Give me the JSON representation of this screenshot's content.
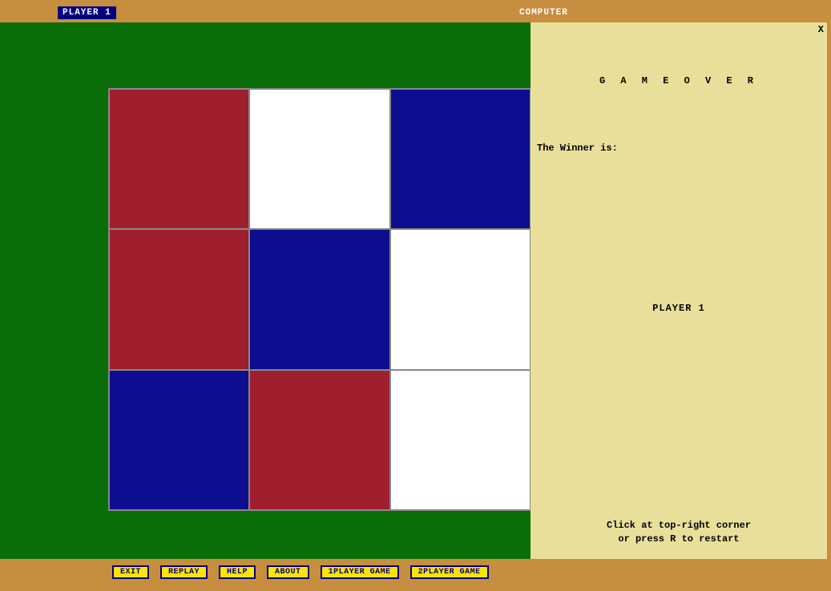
{
  "header": {
    "player1_label": "PLAYER 1",
    "computer_label": "COMPUTER"
  },
  "board": {
    "cells": [
      "red",
      "white",
      "blue",
      "red",
      "blue",
      "white",
      "blue",
      "red",
      "white"
    ]
  },
  "side_panel": {
    "close_symbol": "X",
    "game_over": "G A M E  O V E R",
    "winner_label": "The Winner is:",
    "winner_name": "PLAYER 1",
    "restart_line1": "Click at top-right corner",
    "restart_line2": "or press R to restart"
  },
  "buttons": {
    "exit": "EXIT",
    "replay": "REPLAY",
    "help": "HELP",
    "about": "ABOUT",
    "one_player": "1PLAYER GAME",
    "two_player": "2PLAYER GAME"
  }
}
